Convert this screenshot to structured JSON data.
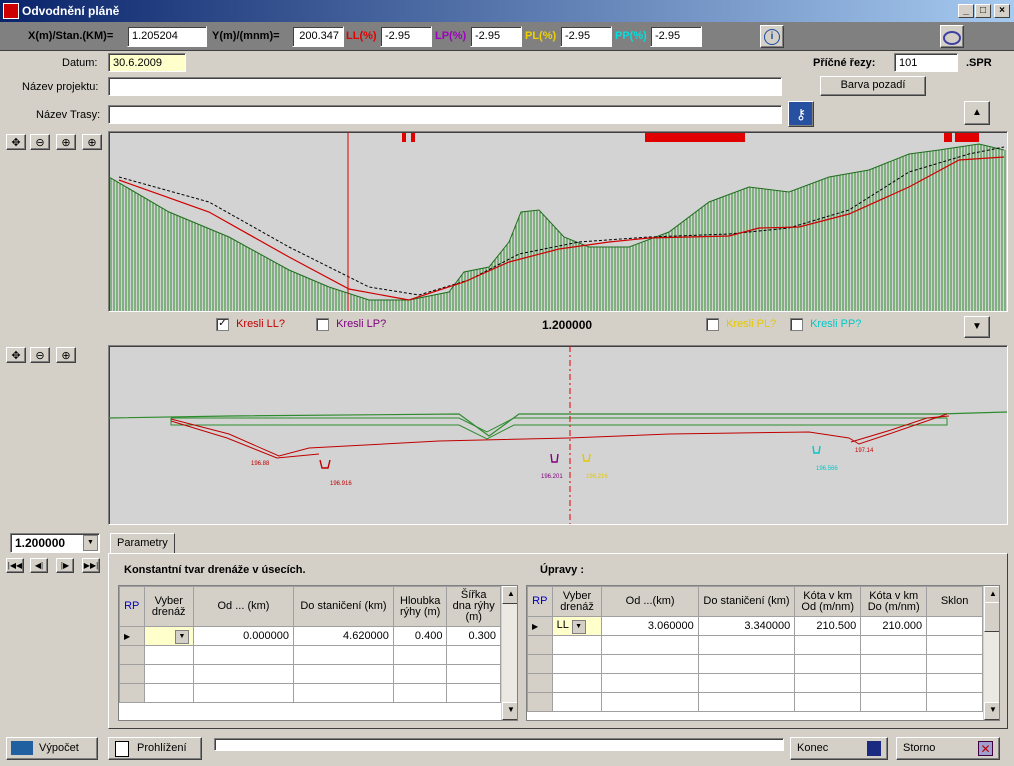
{
  "window": {
    "title": "Odvodnění pláně"
  },
  "toolbar": {
    "x_label": "X(m)/Stan.(KM)=",
    "x_value": "1.205204",
    "y_label": "Y(m)/(mnm)=",
    "y_value": "200.347",
    "ll_label": "LL(%)",
    "ll_value": "-2.95",
    "lp_label": "LP(%)",
    "lp_value": "-2.95",
    "pl_label": "PL(%)",
    "pl_value": "-2.95",
    "pp_label": "PP(%)",
    "pp_value": "-2.95"
  },
  "form": {
    "datum_label": "Datum:",
    "datum_value": "30.6.2009",
    "project_label": "Název projektu:",
    "project_value": "",
    "route_label": "Název Trasy:",
    "route_value": "",
    "cross_label": "Příčné řezy:",
    "cross_value": "101",
    "cross_ext": ".SPR",
    "bg_button": "Barva pozadí"
  },
  "profile": {
    "station": "1.200000",
    "checks": [
      {
        "label": "Kresli LL?",
        "checked": true,
        "color": "#c00000"
      },
      {
        "label": "Kresli LP?",
        "checked": false,
        "color": "#800080"
      },
      {
        "label": "Kresli PL?",
        "checked": false,
        "color": "#e6c800"
      },
      {
        "label": "Kresli PP?",
        "checked": false,
        "color": "#00c8c8"
      }
    ]
  },
  "cross_section": {
    "labels": [
      "196.88",
      "196.916",
      "196.201",
      "196.216",
      "196.566",
      "197.14"
    ]
  },
  "station_select": "1.200000",
  "tab": "Parametry",
  "left_table": {
    "title": "Konstantní tvar drenáže v úsecích.",
    "headers": [
      "RP",
      "Vyber drenáž",
      "Od ... (km)",
      "Do staničení (km)",
      "Hloubka rýhy (m)",
      "Šířka dna rýhy (m)"
    ],
    "rows": [
      [
        "",
        "",
        "0.000000",
        "4.620000",
        "0.400",
        "0.300"
      ]
    ]
  },
  "right_table": {
    "title": "Úpravy :",
    "headers": [
      "RP",
      "Vyber drenáž",
      "Od ...(km)",
      "Do staničení (km)",
      "Kóta v km Od (m/nm)",
      "Kóta v km Do (m/nm)",
      "Sklon"
    ],
    "rows": [
      [
        "",
        "LL",
        "3.060000",
        "3.340000",
        "210.500",
        "210.000",
        ""
      ]
    ]
  },
  "bottom": {
    "calc": "Výpočet",
    "view": "Prohlížení",
    "end": "Konec",
    "cancel": "Storno"
  },
  "chart_data": null
}
